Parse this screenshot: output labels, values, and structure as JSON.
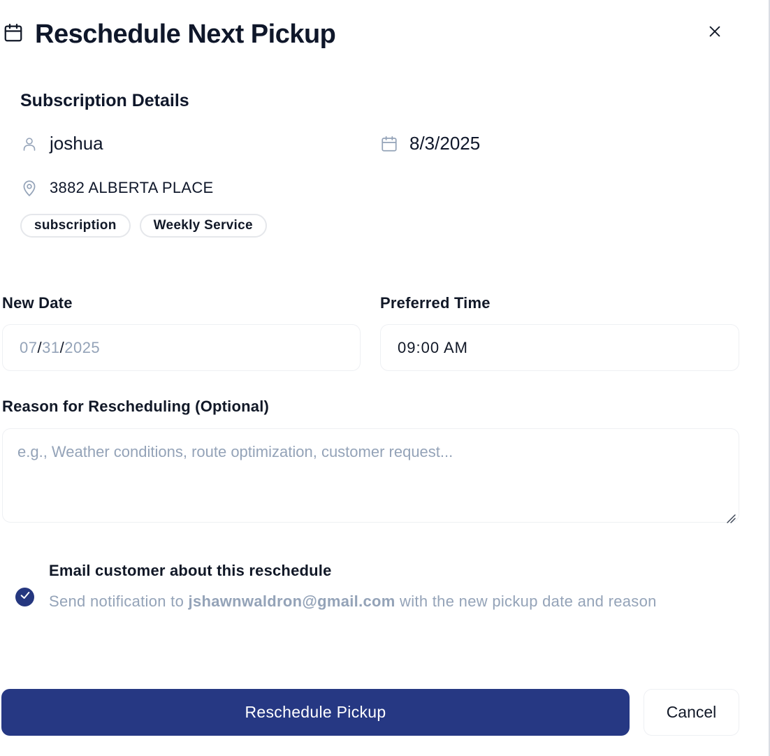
{
  "dialog": {
    "title": "Reschedule Next Pickup",
    "title_icon": "calendar-icon",
    "close_icon": "close-icon"
  },
  "subscription": {
    "section_title": "Subscription Details",
    "customer_name": "joshua",
    "date": "8/3/2025",
    "address": "3882 ALBERTA PLACE",
    "badges": [
      "subscription",
      "Weekly Service"
    ]
  },
  "form": {
    "new_date_label": "New Date",
    "new_date": {
      "month": "07",
      "day": "31",
      "year": "2025",
      "separator": "/"
    },
    "preferred_time_label": "Preferred Time",
    "preferred_time": "09:00 AM",
    "reason_label": "Reason for Rescheduling (Optional)",
    "reason_placeholder": "e.g., Weather conditions, route optimization, customer request...",
    "reason_value": ""
  },
  "notification": {
    "checked": true,
    "title": "Email customer about this reschedule",
    "desc_prefix": "Send notification to ",
    "email": "jshawnwaldron@gmail.com",
    "desc_suffix": " with the new pickup date and reason"
  },
  "actions": {
    "primary_label": "Reschedule Pickup",
    "cancel_label": "Cancel"
  },
  "colors": {
    "primary": "#263883",
    "text": "#0f172a",
    "muted": "#94a3b8",
    "border": "#e5e7eb"
  }
}
